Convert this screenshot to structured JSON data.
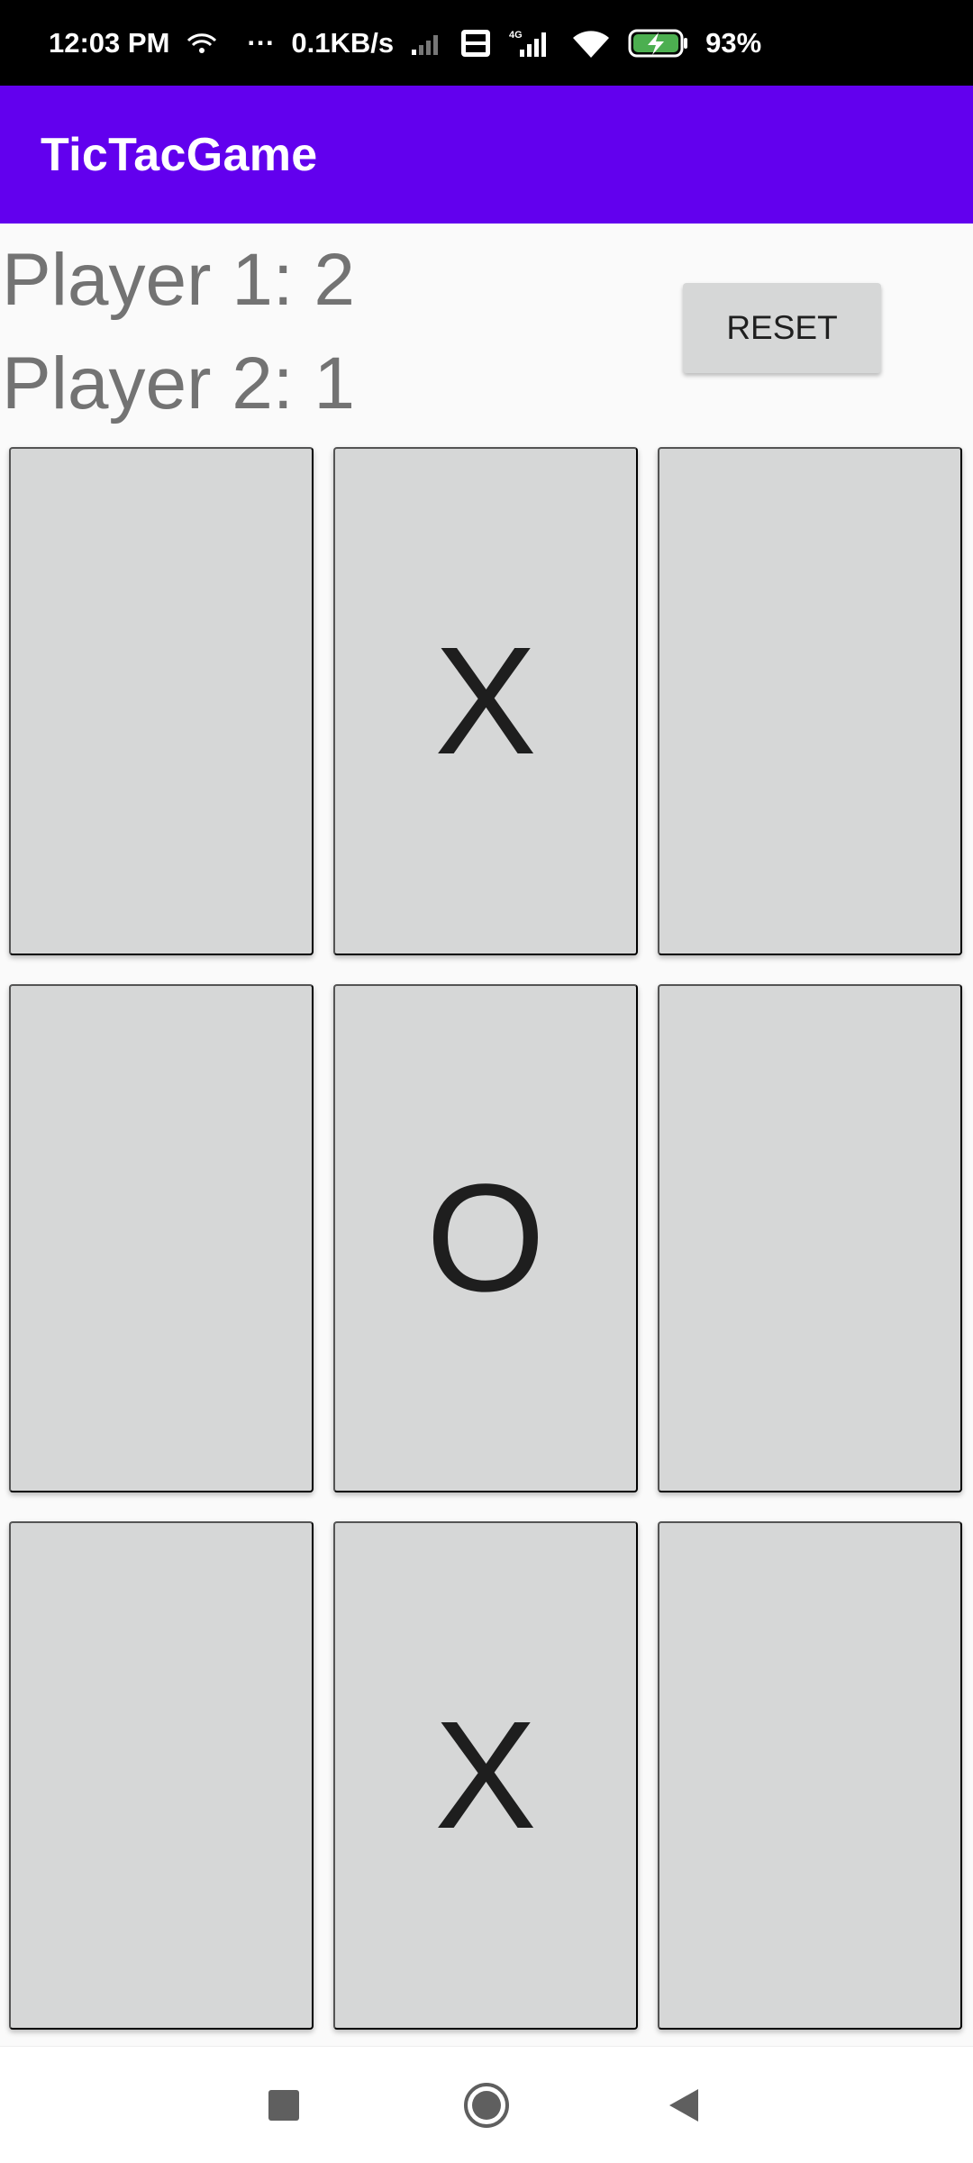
{
  "status_bar": {
    "time": "12:03 PM",
    "more": "···",
    "net_speed": "0.1KB/s",
    "volte": "Vo LTE",
    "network_type": "4G",
    "battery": "93%",
    "battery_level": 0.93,
    "icons": [
      "hotspot-icon",
      "signal-icon",
      "volte-icon",
      "signal-4g-icon",
      "wifi-icon",
      "battery-charging-icon"
    ]
  },
  "app_bar": {
    "title": "TicTacGame"
  },
  "scores": {
    "player1": "Player 1: 2",
    "player2": "Player 2: 1"
  },
  "reset_label": "RESET",
  "board": {
    "cells": [
      "",
      "X",
      "",
      "",
      "O",
      "",
      "",
      "X",
      ""
    ]
  },
  "nav": {
    "icons": [
      "recents-square-icon",
      "home-circle-icon",
      "back-triangle-icon"
    ]
  },
  "colors": {
    "app_bar": "#6200ee",
    "cell": "#d6d7d7",
    "score_text": "#737373",
    "background": "#fafafa"
  }
}
